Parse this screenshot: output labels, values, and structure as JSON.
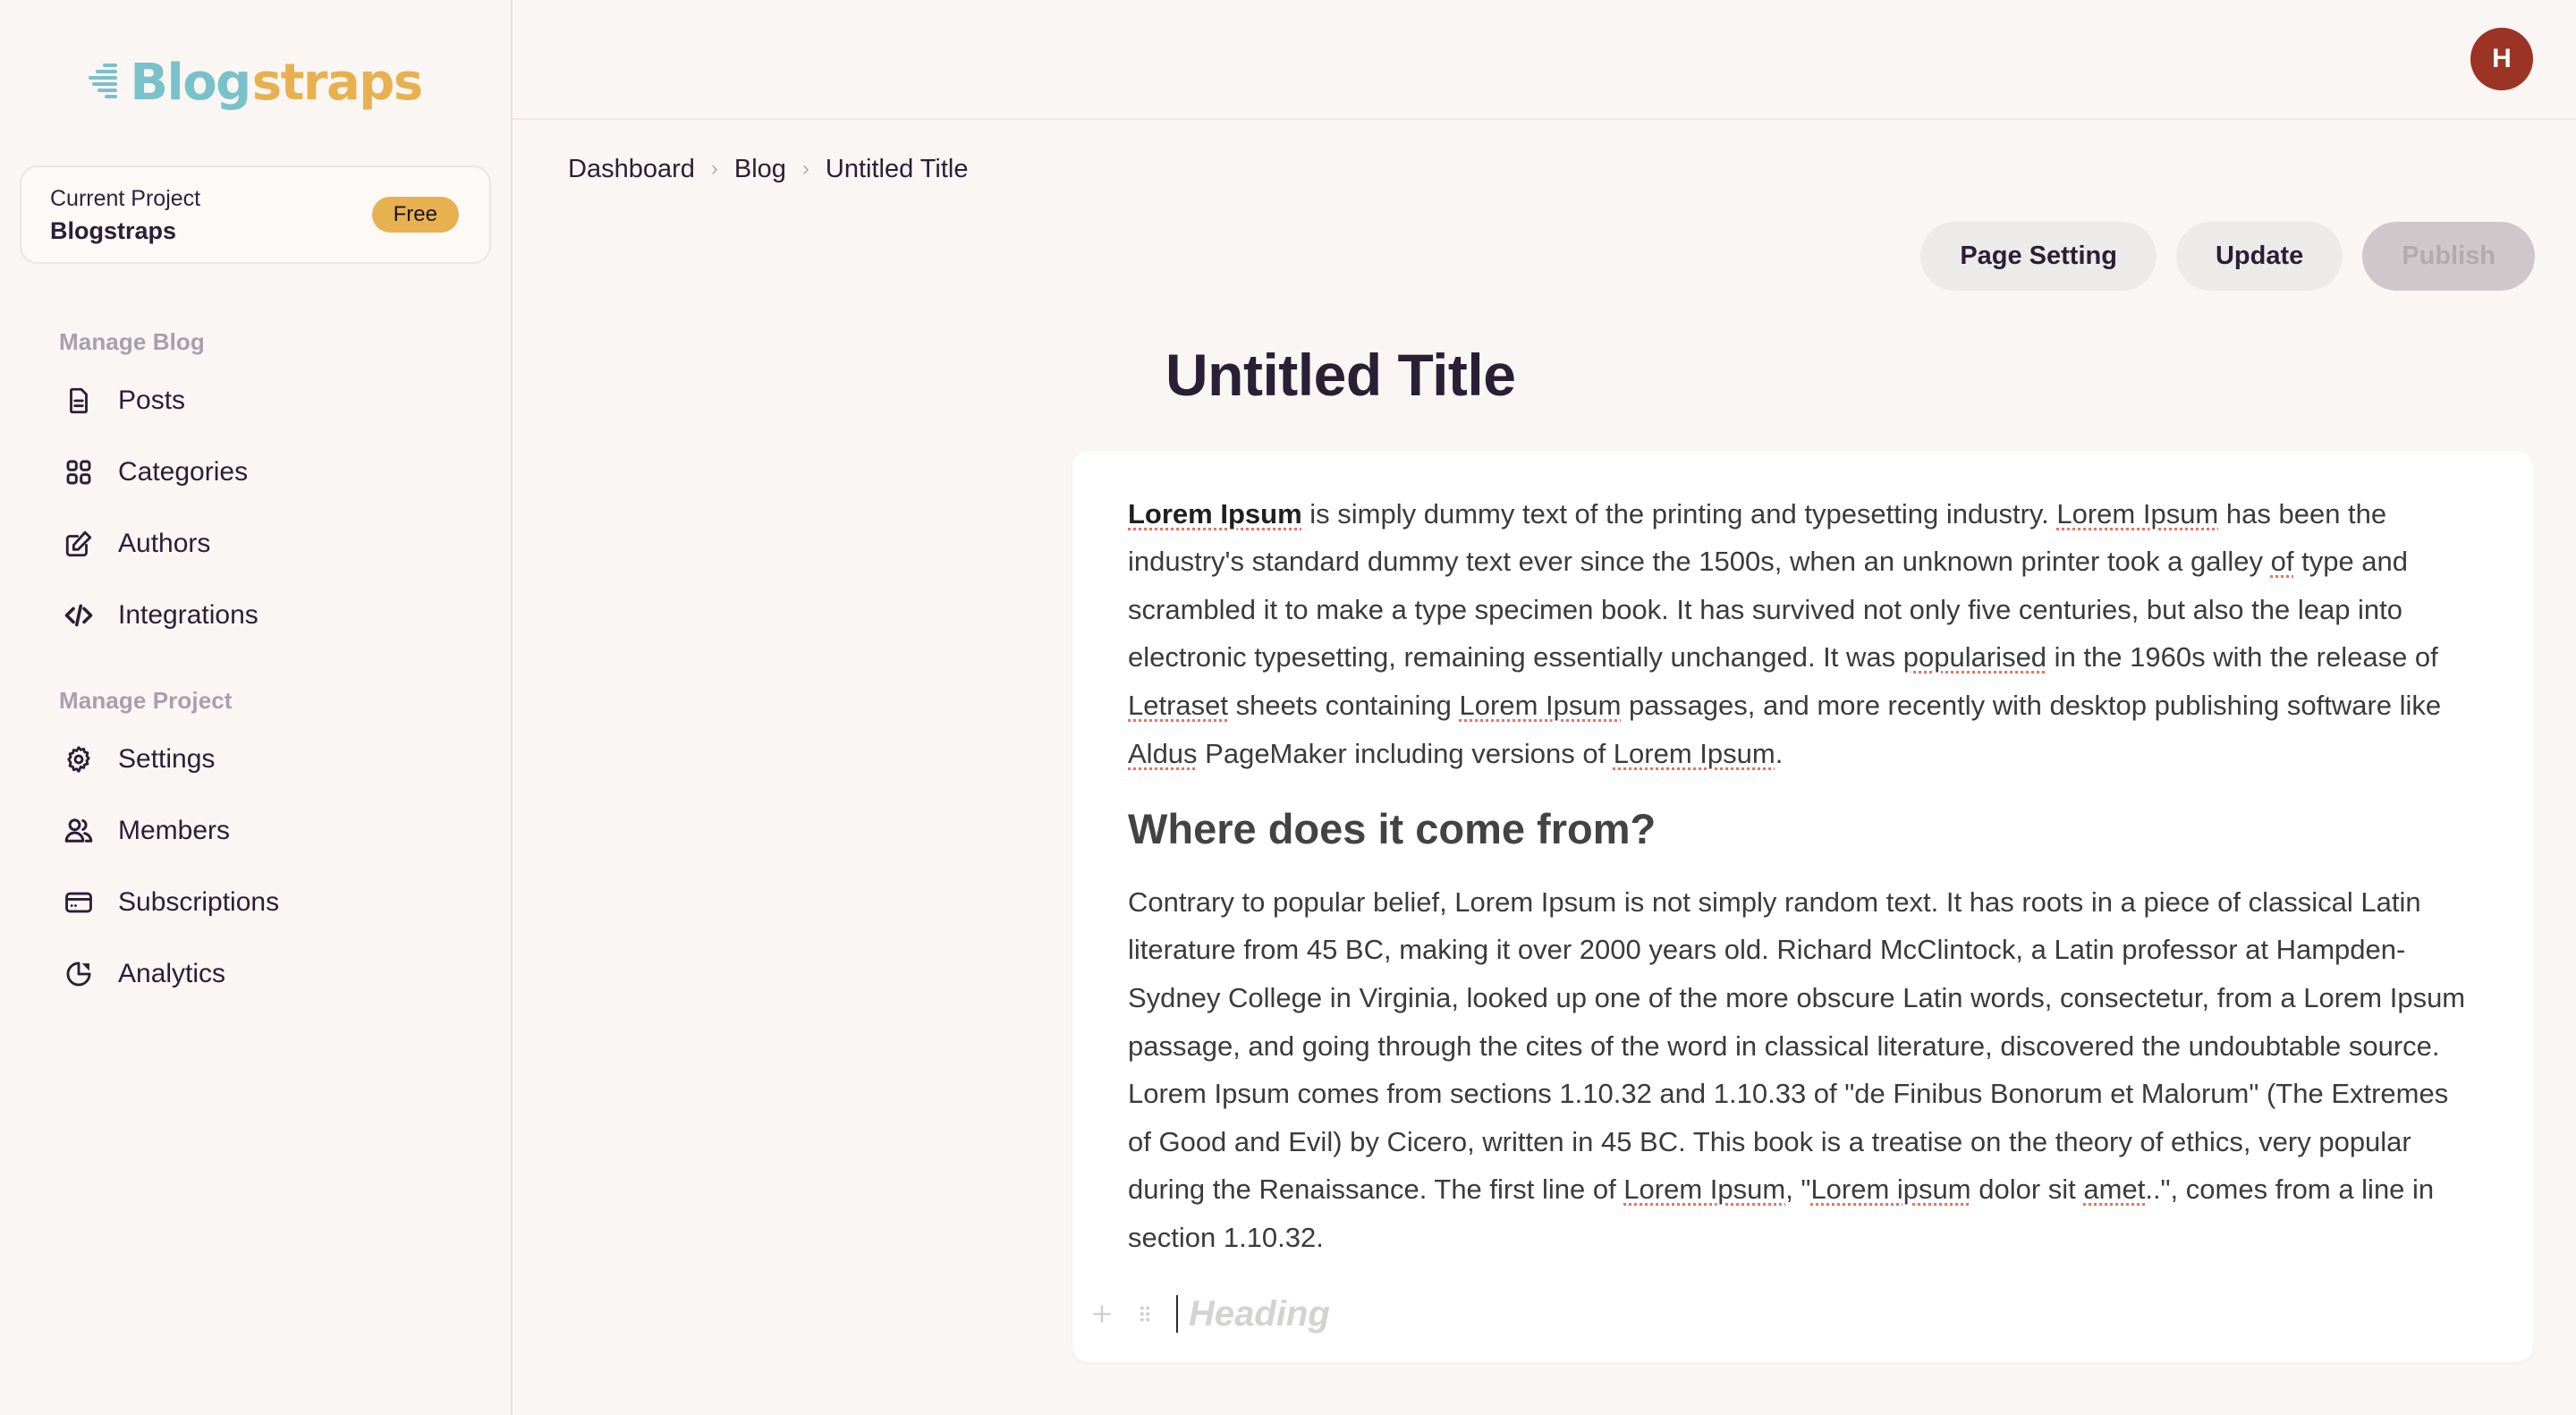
{
  "brand": {
    "logo_blog": "Blog",
    "logo_straps": "straps",
    "color_teal": "#79c2c9",
    "color_amber": "#e8b14f"
  },
  "sidebar": {
    "project": {
      "label": "Current Project",
      "name": "Blogstraps",
      "badge": "Free"
    },
    "sections": [
      {
        "title": "Manage Blog",
        "items": [
          {
            "label": "Posts",
            "icon": "document-icon"
          },
          {
            "label": "Categories",
            "icon": "grid-icon"
          },
          {
            "label": "Authors",
            "icon": "edit-square-icon"
          },
          {
            "label": "Integrations",
            "icon": "code-icon"
          }
        ]
      },
      {
        "title": "Manage Project",
        "items": [
          {
            "label": "Settings",
            "icon": "gear-icon"
          },
          {
            "label": "Members",
            "icon": "users-icon"
          },
          {
            "label": "Subscriptions",
            "icon": "credit-card-icon"
          },
          {
            "label": "Analytics",
            "icon": "pie-chart-icon"
          }
        ]
      }
    ]
  },
  "topbar": {
    "avatar_initial": "H",
    "avatar_color": "#9c3425"
  },
  "breadcrumb": {
    "items": [
      "Dashboard",
      "Blog",
      "Untitled Title"
    ],
    "separator": "›"
  },
  "actions": {
    "page_setting": "Page Setting",
    "update": "Update",
    "publish": "Publish"
  },
  "document": {
    "title": "Untitled Title",
    "paragraph_1_lead": "Lorem Ipsum",
    "paragraph_1_a": " is simply dummy text of the printing and typesetting industry. ",
    "paragraph_1_sp2": "Lorem Ipsum",
    "paragraph_1_b": " has been the industry's standard dummy text ever since the 1500s, when an unknown printer took a galley ",
    "paragraph_1_sp3": "of",
    "paragraph_1_c": " type and scrambled it to make a type specimen book. It has survived not only five centuries, but also the leap into electronic typesetting, remaining essentially unchanged. It was ",
    "paragraph_1_sp4": "popularised",
    "paragraph_1_d": " in the 1960s with the release of ",
    "paragraph_1_sp5": "Letraset",
    "paragraph_1_e": " sheets containing ",
    "paragraph_1_sp6": "Lorem Ipsum",
    "paragraph_1_f": " passages, and more recently with desktop publishing software like ",
    "paragraph_1_sp7": "Aldus",
    "paragraph_1_g": " PageMaker including versions of ",
    "paragraph_1_sp8": "Lorem Ipsum",
    "paragraph_1_h": ".",
    "heading_2": "Where does it come from?",
    "paragraph_2_a": "Contrary to popular belief, Lorem Ipsum is not simply random text. It has roots in a piece of classical Latin literature from 45 BC, making it over 2000 years old. Richard McClintock, a Latin professor at Hampden-Sydney College in Virginia, looked up one of the more obscure Latin words, consectetur, from a Lorem Ipsum passage, and going through the cites of the word in classical literature, discovered the undoubtable source. Lorem Ipsum comes from sections 1.10.32 and 1.10.33 of \"de Finibus Bonorum et Malorum\" (The Extremes of Good and Evil) by Cicero, written in 45 BC. This book is a treatise on the theory of ethics, very popular during the Renaissance. The first line of ",
    "paragraph_2_sp1": "Lorem Ipsum",
    "paragraph_2_b": ", \"",
    "paragraph_2_sp2": "Lorem ipsum",
    "paragraph_2_c": " dolor sit ",
    "paragraph_2_sp3": "amet",
    "paragraph_2_d": "..\", comes from a line in section 1.10.32.",
    "block_placeholder": "Heading"
  }
}
